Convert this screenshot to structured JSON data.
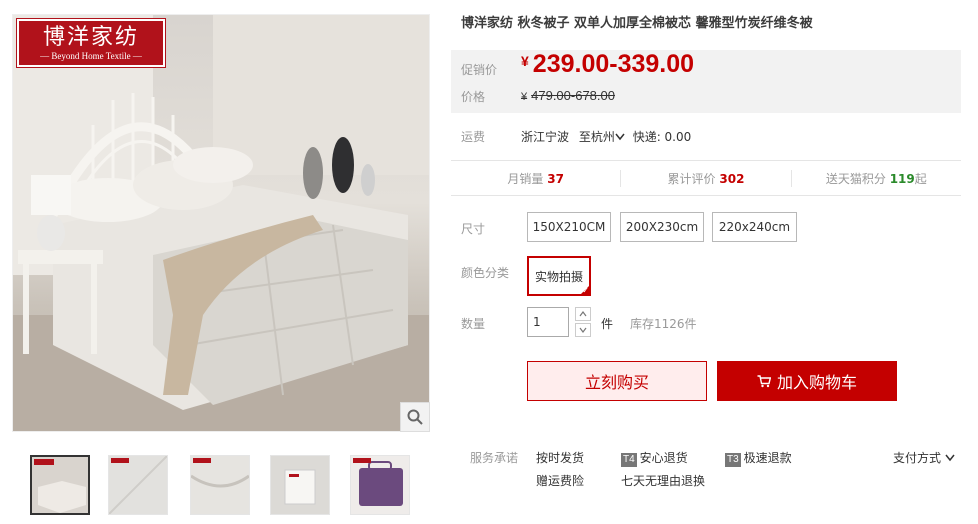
{
  "brand": {
    "name_cn": "博洋家纺",
    "name_en": "— Beyond Home Textile —"
  },
  "product": {
    "title": "博洋家纺 秋冬被子 双单人加厚全棉被芯 馨雅型竹炭纤维冬被"
  },
  "price": {
    "promo_label": "促销价",
    "orig_label": "价格",
    "currency": "¥",
    "promo_value": "239.00-339.00",
    "orig_value": "479.00-678.00"
  },
  "shipping": {
    "label": "运费",
    "from": "浙江宁波",
    "to": "至杭州",
    "courier": "快递: 0.00"
  },
  "stats": {
    "monthly_label": "月销量",
    "monthly_value": "37",
    "reviews_label": "累计评价",
    "reviews_value": "302",
    "points_label": "送天猫积分",
    "points_value": "119",
    "points_suffix": "起"
  },
  "sizes": {
    "label": "尺寸",
    "options": [
      "150X210CM",
      "200X230cm",
      "220x240cm"
    ]
  },
  "colors": {
    "label": "颜色分类",
    "selected": "实物拍摄"
  },
  "quantity": {
    "label": "数量",
    "value": "1",
    "unit": "件",
    "stock": "库存1126件"
  },
  "actions": {
    "buy_now": "立刻购买",
    "add_to_cart": "加入购物车"
  },
  "service": {
    "label": "服务承诺",
    "items": [
      "按时发货",
      "安心退货",
      "极速退款",
      "赠运费险",
      "七天无理由退换"
    ],
    "badges": [
      "T4",
      "T3"
    ]
  },
  "payment": {
    "label": "支付方式"
  },
  "colors_theme": {
    "accent": "#c40000",
    "brand_red": "#b1121b"
  }
}
